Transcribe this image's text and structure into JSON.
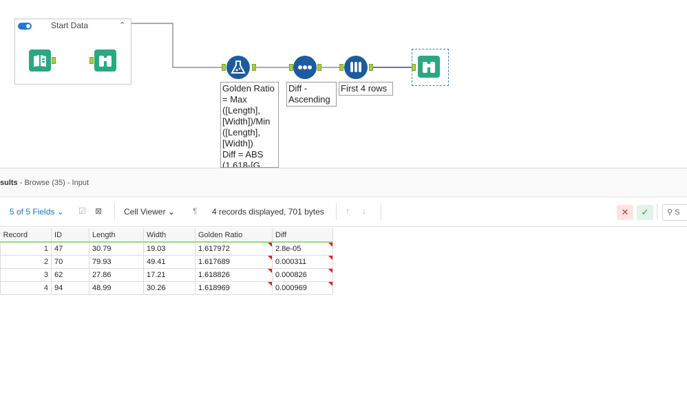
{
  "canvas": {
    "container": {
      "title": "Start Data"
    },
    "labels": {
      "formula": "Golden Ratio\n= Max\n([Length],\n[Width])/Min\n([Length],\n[Width])\nDiff = ABS\n(1.618-[G",
      "sort": "Diff -\nAscending",
      "sample": "First 4 rows"
    },
    "icons": {
      "input": "book-icon",
      "browse": "binoculars-icon",
      "formula": "flask-icon",
      "sort": "dots-icon",
      "sample": "test-tubes-icon"
    }
  },
  "results": {
    "title_prefix": "sults",
    "title_suffix": " - Browse (35) - Input",
    "toolbar": {
      "fields": "5 of 5 Fields",
      "cell_viewer": "Cell Viewer",
      "status": "4 records displayed, 701 bytes",
      "search": "S"
    },
    "columns": [
      "Record",
      "ID",
      "Length",
      "Width",
      "Golden Ratio",
      "Diff"
    ],
    "rows": [
      [
        "1",
        "47",
        "30.79",
        "19.03",
        "1.617972",
        "2.8e-05"
      ],
      [
        "2",
        "70",
        "79.93",
        "49.41",
        "1.617689",
        "0.000311"
      ],
      [
        "3",
        "62",
        "27.86",
        "17.21",
        "1.618826",
        "0.000826"
      ],
      [
        "4",
        "94",
        "48.99",
        "30.26",
        "1.618969",
        "0.000969"
      ]
    ]
  },
  "colors": {
    "accent_blue": "#1f6fc5",
    "tool_green": "#2ba87f",
    "tool_blue": "#1c5c9c",
    "anchor_green": "#a8cf45",
    "flag_red": "#e01f1f"
  }
}
